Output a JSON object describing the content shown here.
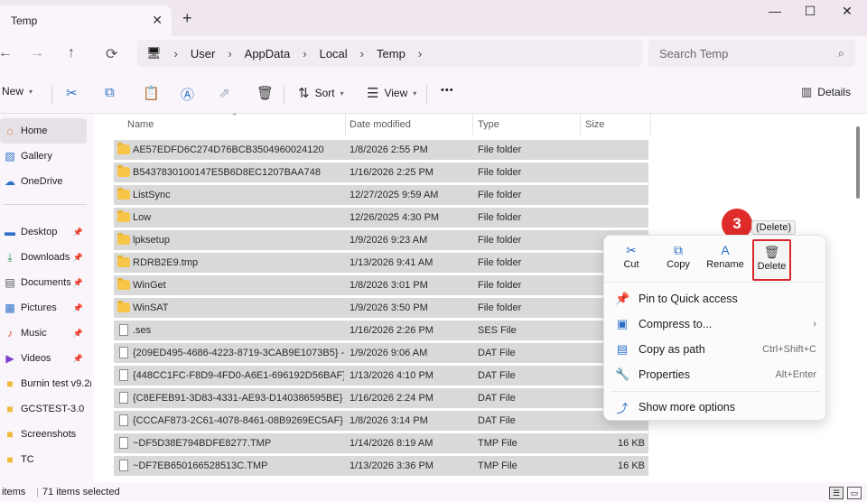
{
  "tab": {
    "title": "Temp",
    "close_glyph": "✕",
    "add_glyph": "+"
  },
  "window": {
    "minimize": "—",
    "maximize": "☐",
    "close": "✕"
  },
  "nav": {
    "back": "←",
    "forward": "→",
    "up": "↑",
    "refresh": "⟳"
  },
  "address": {
    "crumbs": [
      "User",
      "AppData",
      "Local",
      "Temp"
    ],
    "sep": "›"
  },
  "search": {
    "placeholder": "Search Temp"
  },
  "toolbar": {
    "new_label": "New",
    "sort_label": "Sort",
    "view_label": "View",
    "more_glyph": "•••",
    "details_label": "Details"
  },
  "sidebar": {
    "items": [
      {
        "label": "Home",
        "icon": "home-icon"
      },
      {
        "label": "Gallery",
        "icon": "gallery-icon"
      },
      {
        "label": "OneDrive",
        "icon": "cloud-icon"
      },
      {
        "label": "Desktop",
        "icon": "desktop-icon"
      },
      {
        "label": "Downloads",
        "icon": "download-icon"
      },
      {
        "label": "Documents",
        "icon": "document-icon"
      },
      {
        "label": "Pictures",
        "icon": "pictures-icon"
      },
      {
        "label": "Music",
        "icon": "music-icon"
      },
      {
        "label": "Videos",
        "icon": "video-icon"
      },
      {
        "label": "Burnin test v9.2(",
        "icon": "folder-icon"
      },
      {
        "label": "GCSTEST-3.0",
        "icon": "folder-icon"
      },
      {
        "label": "Screenshots",
        "icon": "folder-icon"
      },
      {
        "label": "TC",
        "icon": "folder-icon"
      }
    ]
  },
  "columns": {
    "name": "Name",
    "date": "Date modified",
    "type": "Type",
    "size": "Size"
  },
  "files": [
    {
      "name": "AE57EDFD6C274D76BCB3504960024120",
      "date": "1/8/2026 2:55 PM",
      "type": "File folder",
      "size": "",
      "kind": "folder"
    },
    {
      "name": "B5437830100147E5B6D8EC1207BAA748",
      "date": "1/16/2026 2:25 PM",
      "type": "File folder",
      "size": "",
      "kind": "folder"
    },
    {
      "name": "ListSync",
      "date": "12/27/2025 9:59 AM",
      "type": "File folder",
      "size": "",
      "kind": "folder"
    },
    {
      "name": "Low",
      "date": "12/26/2025 4:30 PM",
      "type": "File folder",
      "size": "",
      "kind": "folder"
    },
    {
      "name": "lpksetup",
      "date": "1/9/2026 9:23 AM",
      "type": "File folder",
      "size": "",
      "kind": "folder"
    },
    {
      "name": "RDRB2E9.tmp",
      "date": "1/13/2026 9:41 AM",
      "type": "File folder",
      "size": "",
      "kind": "folder"
    },
    {
      "name": "WinGet",
      "date": "1/8/2026 3:01 PM",
      "type": "File folder",
      "size": "",
      "kind": "folder"
    },
    {
      "name": "WinSAT",
      "date": "1/9/2026 3:50 PM",
      "type": "File folder",
      "size": "",
      "kind": "folder"
    },
    {
      "name": ".ses",
      "date": "1/16/2026 2:26 PM",
      "type": "SES File",
      "size": "",
      "kind": "file"
    },
    {
      "name": "{209ED495-4686-4223-8719-3CAB9E1073B5} -...",
      "date": "1/9/2026 9:06 AM",
      "type": "DAT File",
      "size": "",
      "kind": "file"
    },
    {
      "name": "{448CC1FC-F8D9-4FD0-A6E1-696192D56BAF} ...",
      "date": "1/13/2026 4:10 PM",
      "type": "DAT File",
      "size": "",
      "kind": "file"
    },
    {
      "name": "{C8EFEB91-3D83-4331-AE93-D140386595BE} -...",
      "date": "1/16/2026 2:24 PM",
      "type": "DAT File",
      "size": "",
      "kind": "file"
    },
    {
      "name": "{CCCAF873-2C61-4078-8461-08B9269EC5AF} -...",
      "date": "1/8/2026 3:14 PM",
      "type": "DAT File",
      "size": "",
      "kind": "file"
    },
    {
      "name": "~DF5D38E794BDFE8277.TMP",
      "date": "1/14/2026 8:19 AM",
      "type": "TMP File",
      "size": "16 KB",
      "kind": "file"
    },
    {
      "name": "~DF7EB650166528513C.TMP",
      "date": "1/13/2026 3:36 PM",
      "type": "TMP File",
      "size": "16 KB",
      "kind": "file"
    }
  ],
  "status": {
    "items": "items",
    "selected": "71 items selected"
  },
  "context_menu": {
    "quick_actions": [
      {
        "label": "Cut",
        "icon": "cut-icon",
        "glyph": "✂"
      },
      {
        "label": "Copy",
        "icon": "copy-icon",
        "glyph": "⧉"
      },
      {
        "label": "Rename",
        "icon": "rename-icon",
        "glyph": "A"
      },
      {
        "label": "Delete",
        "icon": "trash-icon",
        "glyph": "🗑"
      }
    ],
    "items": [
      {
        "label": "Pin to Quick access",
        "shortcut": "",
        "glyph": "📌"
      },
      {
        "label": "Compress to...",
        "shortcut": "›",
        "glyph": "▣"
      },
      {
        "label": "Copy as path",
        "shortcut": "Ctrl+Shift+C",
        "glyph": "▤"
      },
      {
        "label": "Properties",
        "shortcut": "Alt+Enter",
        "glyph": "🔧"
      },
      {
        "label": "Show more options",
        "shortcut": "",
        "glyph": "⤴"
      }
    ],
    "tooltip": "(Delete)"
  },
  "annotation": {
    "step": "3"
  },
  "colors": {
    "highlight_red": "#d9262c",
    "badge_red": "#e02b2b",
    "selection_gray": "#d9d9d9",
    "accent_blue": "#2a6fc9"
  }
}
